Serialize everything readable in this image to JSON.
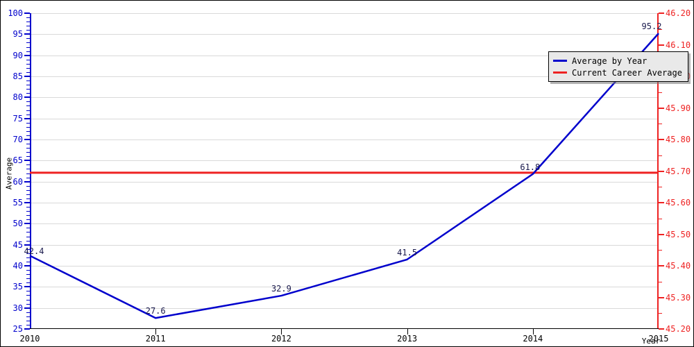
{
  "chart_data": {
    "type": "line",
    "title": "",
    "xlabel": "Year",
    "ylabel": "Average",
    "categories": [
      "2010",
      "2011",
      "2012",
      "2013",
      "2014",
      "2015"
    ],
    "x": [
      2010,
      2011,
      2012,
      2013,
      2014,
      2015
    ],
    "xlim": [
      2010,
      2015
    ],
    "ylim": [
      25,
      100
    ],
    "y_ticks": [
      25,
      30,
      35,
      40,
      45,
      50,
      55,
      60,
      65,
      70,
      75,
      80,
      85,
      90,
      95,
      100
    ],
    "y_minor_step": 1,
    "y2_label": "",
    "y2lim": [
      45.2,
      46.2
    ],
    "y2_ticks": [
      "45.20",
      "45.30",
      "45.40",
      "45.50",
      "45.60",
      "45.70",
      "45.80",
      "45.90",
      "46.00",
      "46.10",
      "46.20"
    ],
    "grid": true,
    "legend_position": "top-right",
    "series": [
      {
        "name": "Average by Year",
        "color": "#0000cc",
        "type": "line",
        "values": [
          42.4,
          27.6,
          32.9,
          41.5,
          61.8,
          95.2
        ],
        "point_labels": [
          "42.4",
          "27.6",
          "32.9",
          "41.5",
          "61.8",
          "95.2"
        ]
      },
      {
        "name": "Current Career Average",
        "color": "#ee2222",
        "type": "hline",
        "value": 62.1
      }
    ],
    "annotations": []
  },
  "legend": {
    "items": [
      {
        "label": "Average by Year",
        "color": "#0000cc"
      },
      {
        "label": "Current Career Average",
        "color": "#ee2222"
      }
    ]
  },
  "axes": {
    "left_color": "#0000cc",
    "right_color": "#ee2222",
    "bottom_color": "#000000",
    "label_color": "#000000"
  },
  "colors": {
    "series_line": "#0000cc",
    "career_line": "#ee2222",
    "gridline": "#d9d9d9",
    "background": "#ffffff",
    "legend_bg": "#e9e9e9",
    "point_label": "#1a1a4d"
  }
}
